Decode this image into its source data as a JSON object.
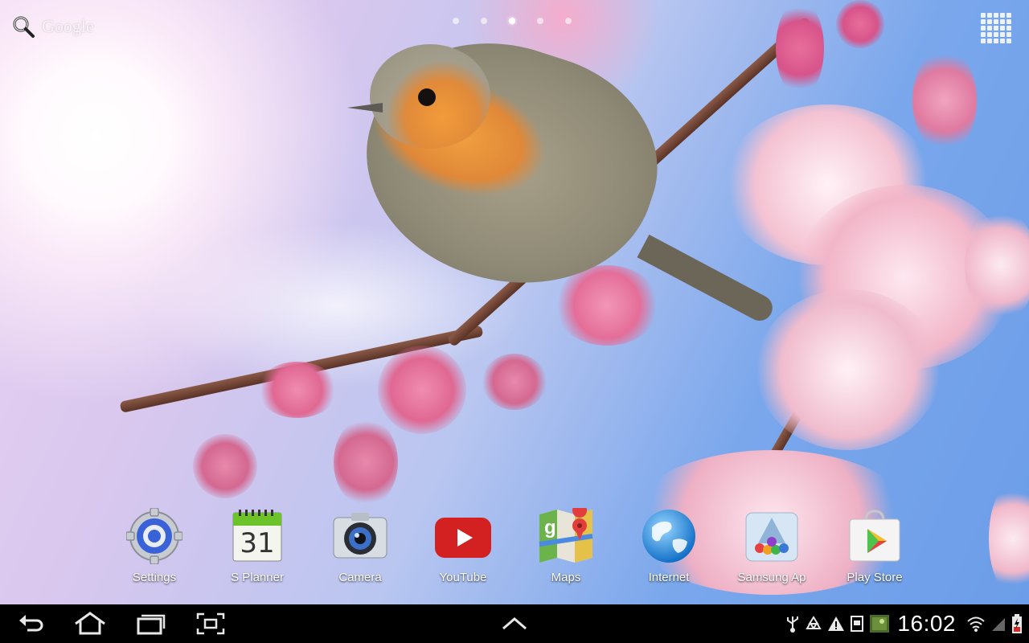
{
  "search": {
    "label": "Google"
  },
  "home_pages": {
    "count": 5,
    "active_index": 2
  },
  "dock": {
    "items": [
      {
        "id": "settings",
        "label": "Settings",
        "icon": "gear-icon"
      },
      {
        "id": "s-planner",
        "label": "S Planner",
        "icon": "calendar-icon",
        "date": "31"
      },
      {
        "id": "camera",
        "label": "Camera",
        "icon": "camera-icon"
      },
      {
        "id": "youtube",
        "label": "YouTube",
        "icon": "youtube-icon"
      },
      {
        "id": "maps",
        "label": "Maps",
        "icon": "maps-icon"
      },
      {
        "id": "internet",
        "label": "Internet",
        "icon": "globe-icon"
      },
      {
        "id": "samsung-apps",
        "label": "Samsung Ap",
        "icon": "samsung-apps-icon"
      },
      {
        "id": "play-store",
        "label": "Play Store",
        "icon": "play-store-icon"
      }
    ]
  },
  "status": {
    "time": "16:02"
  },
  "colors": {
    "navbar": "#000000",
    "youtube": "#d32121",
    "accent": "#33b5e5"
  }
}
